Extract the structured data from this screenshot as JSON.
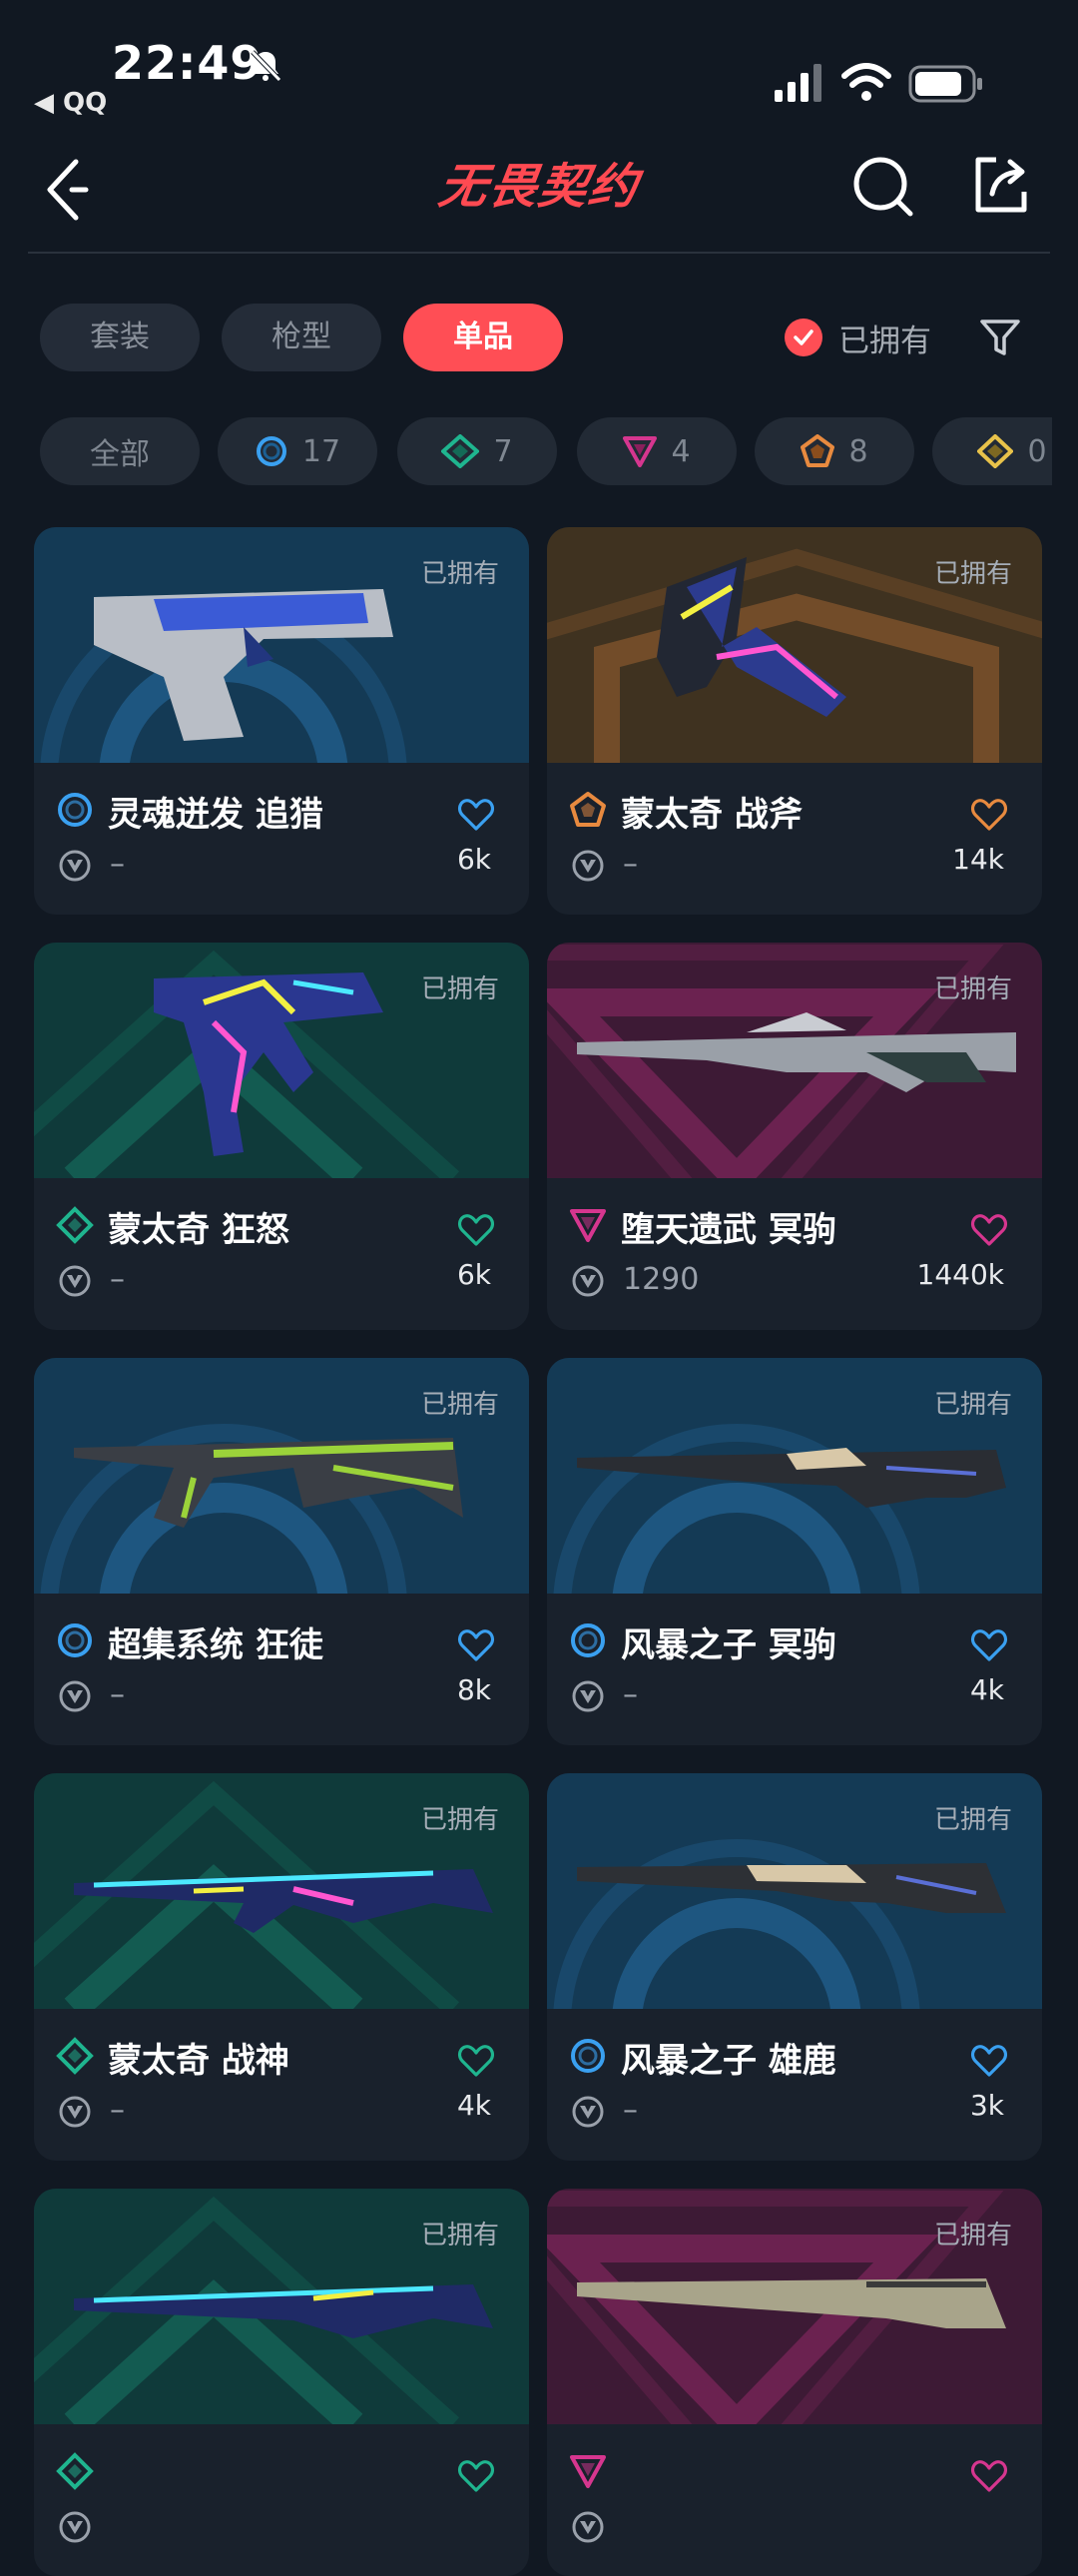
{
  "status": {
    "time": "22:49",
    "back_app": "◀ QQ"
  },
  "header": {
    "logo_text": "无畏契约"
  },
  "tabs": [
    {
      "label": "套装",
      "active": false
    },
    {
      "label": "枪型",
      "active": false
    },
    {
      "label": "单品",
      "active": true
    }
  ],
  "owned_filter": {
    "label": "已拥有",
    "checked": true
  },
  "rarity_chips": [
    {
      "label": "全部",
      "tier": "all"
    },
    {
      "label": "17",
      "tier": "select",
      "color": "#3aa0f0"
    },
    {
      "label": "7",
      "tier": "deluxe",
      "color": "#1fb58f"
    },
    {
      "label": "4",
      "tier": "premium",
      "color": "#d6368f"
    },
    {
      "label": "8",
      "tier": "exclusive",
      "color": "#e88a3f"
    },
    {
      "label": "0",
      "tier": "ultra",
      "color": "#e8c24a"
    }
  ],
  "cards": [
    {
      "name": "灵魂迸发 追猎",
      "tier": "select",
      "tier_color": "#3aa0f0",
      "bg": "#143a55",
      "owned": "已拥有",
      "price": "–",
      "count": "6k"
    },
    {
      "name": "蒙太奇 战斧",
      "tier": "exclusive",
      "tier_color": "#e88a3f",
      "bg": "#3f3220",
      "owned": "已拥有",
      "price": "–",
      "count": "14k"
    },
    {
      "name": "蒙太奇 狂怒",
      "tier": "deluxe",
      "tier_color": "#1fb58f",
      "bg": "#0f3a3a",
      "owned": "已拥有",
      "price": "–",
      "count": "6k"
    },
    {
      "name": "堕天遗武 冥驹",
      "tier": "premium",
      "tier_color": "#d6368f",
      "bg": "#3d1a35",
      "owned": "已拥有",
      "price": "1290",
      "count": "1440k"
    },
    {
      "name": "超集系统 狂徒",
      "tier": "select",
      "tier_color": "#3aa0f0",
      "bg": "#143a55",
      "owned": "已拥有",
      "price": "–",
      "count": "8k"
    },
    {
      "name": "风暴之子 冥驹",
      "tier": "select",
      "tier_color": "#3aa0f0",
      "bg": "#143a55",
      "owned": "已拥有",
      "price": "–",
      "count": "4k"
    },
    {
      "name": "蒙太奇 战神",
      "tier": "deluxe",
      "tier_color": "#1fb58f",
      "bg": "#0f3a3a",
      "owned": "已拥有",
      "price": "–",
      "count": "4k"
    },
    {
      "name": "风暴之子 雄鹿",
      "tier": "select",
      "tier_color": "#3aa0f0",
      "bg": "#143a55",
      "owned": "已拥有",
      "price": "–",
      "count": "3k"
    },
    {
      "name": "",
      "tier": "deluxe",
      "tier_color": "#1fb58f",
      "bg": "#0f3a3a",
      "owned": "已拥有",
      "price": "",
      "count": ""
    },
    {
      "name": "",
      "tier": "premium",
      "tier_color": "#d6368f",
      "bg": "#3d1a35",
      "owned": "已拥有",
      "price": "",
      "count": ""
    }
  ]
}
